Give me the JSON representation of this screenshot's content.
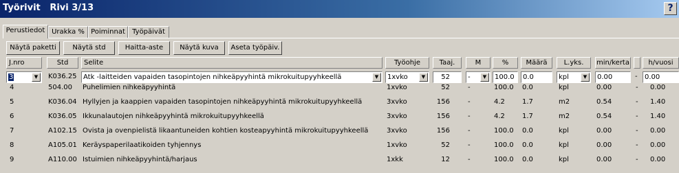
{
  "window": {
    "title": "Työrivit   Rivi 3/13",
    "help_label": "?"
  },
  "tabs": [
    {
      "label": "Perustiedot",
      "active": true
    },
    {
      "label": "Urakka %",
      "active": false
    },
    {
      "label": "Poiminnat",
      "active": false
    },
    {
      "label": "Työpäivät",
      "active": false
    }
  ],
  "toolbar": {
    "show_package": "Näytä paketti",
    "show_std": "Näytä std",
    "haitta": "Haitta-aste",
    "show_image": "Näytä kuva",
    "set_workday": "Aseta työpäiv."
  },
  "columns": {
    "jnro": "J.nro",
    "std": "Std",
    "selite": "Selite",
    "tyoohje": "Työohje",
    "taaj": "Taaj.",
    "m": "M",
    "pct": "%",
    "maara": "Määrä",
    "lyks": "L.yks.",
    "minkerta": "min/kerta",
    "hvuosi": "h/vuosi"
  },
  "edit_row": {
    "jnro": "3",
    "std": "K036.25",
    "selite": "Atk -laitteiden vapaiden tasopintojen nihkeäpyyhintä mikrokuitupyyhkeellä",
    "tyoohje": "1xvko",
    "taaj": "52",
    "m": "-",
    "pct": "100.0",
    "maara": "0.0",
    "lyks": "kpl",
    "minkerta": "0.00",
    "dash": "-",
    "hvuosi": "0.00"
  },
  "rows": [
    {
      "jnro": "4",
      "std": "504.00",
      "selite": "Puhelimien nihkeäpyyhintä",
      "tyoohje": "1xvko",
      "taaj": "52",
      "m": "-",
      "pct": "100.0",
      "maara": "0.0",
      "lyks": "kpl",
      "minkerta": "0.00",
      "dash": "-",
      "hvuosi": "0.00"
    },
    {
      "jnro": "5",
      "std": "K036.04",
      "selite": "Hyllyjen ja kaappien vapaiden tasopintojen nihkeäpyyhintä mikrokuitupyyhkeellä",
      "tyoohje": "3xvko",
      "taaj": "156",
      "m": "-",
      "pct": "4.2",
      "maara": "1.7",
      "lyks": "m2",
      "minkerta": "0.54",
      "dash": "-",
      "hvuosi": "1.40"
    },
    {
      "jnro": "6",
      "std": "K036.05",
      "selite": "Ikkunalautojen nihkeäpyyhintä mikrokuitupyyhkeellä",
      "tyoohje": "3xvko",
      "taaj": "156",
      "m": "-",
      "pct": "4.2",
      "maara": "1.7",
      "lyks": "m2",
      "minkerta": "0.54",
      "dash": "-",
      "hvuosi": "1.40"
    },
    {
      "jnro": "7",
      "std": "A102.15",
      "selite": "Ovista ja ovenpielistä likaantuneiden kohtien kosteapyyhintä mikrokuitupyyhkeellä",
      "tyoohje": "3xvko",
      "taaj": "156",
      "m": "-",
      "pct": "100.0",
      "maara": "0.0",
      "lyks": "kpl",
      "minkerta": "0.00",
      "dash": "-",
      "hvuosi": "0.00"
    },
    {
      "jnro": "8",
      "std": "A105.01",
      "selite": "Keräyspaperilaatikoiden tyhjennys",
      "tyoohje": "1xvko",
      "taaj": "52",
      "m": "-",
      "pct": "100.0",
      "maara": "0.0",
      "lyks": "kpl",
      "minkerta": "0.00",
      "dash": "-",
      "hvuosi": "0.00"
    },
    {
      "jnro": "9",
      "std": "A110.00",
      "selite": "Istuimien nihkeäpyyhintä/harjaus",
      "tyoohje": "1xkk",
      "taaj": "12",
      "m": "-",
      "pct": "100.0",
      "maara": "0.0",
      "lyks": "kpl",
      "minkerta": "0.00",
      "dash": "-",
      "hvuosi": "0.00"
    }
  ]
}
